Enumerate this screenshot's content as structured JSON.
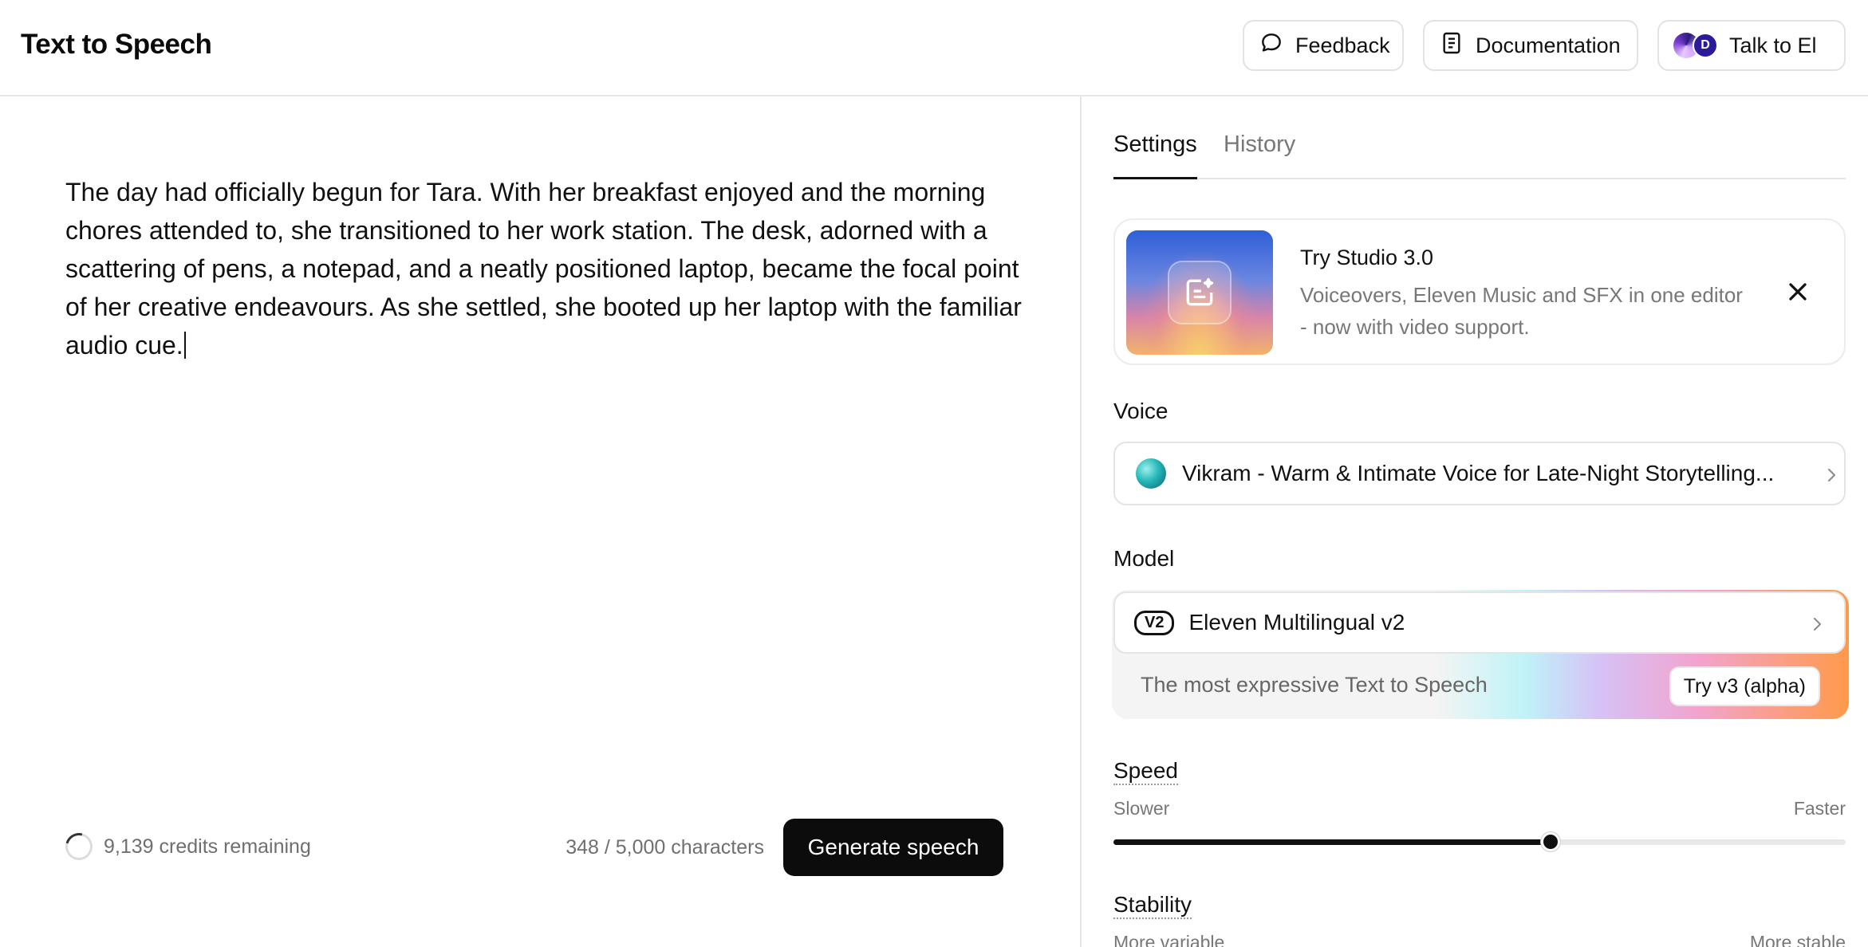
{
  "header": {
    "title": "Text to Speech",
    "feedback_label": "Feedback",
    "docs_label": "Documentation",
    "talk_label": "Talk to El",
    "avatar_initial": "D"
  },
  "editor": {
    "text": "The day had officially begun for Tara. With her breakfast enjoyed and the morning chores attended to, she transitioned to her work station. The desk, adorned with a scattering of pens, a notepad, and a neatly positioned laptop, became the focal point of her creative endeavours. As she settled, she booted up her laptop with the familiar audio cue.",
    "credits": "9,139 credits remaining",
    "char_count": "348 / 5,000 characters",
    "generate_label": "Generate speech"
  },
  "panel": {
    "tabs": [
      {
        "label": "Settings",
        "active": true
      },
      {
        "label": "History",
        "active": false
      }
    ],
    "promo": {
      "title": "Try Studio 3.0",
      "description": "Voiceovers, Eleven Music and SFX in one editor - now with video support."
    },
    "voice_label": "Voice",
    "voice_name": "Vikram - Warm & Intimate Voice for Late-Night Storytelling...",
    "model_label": "Model",
    "model": {
      "badge": "V2",
      "name": "Eleven Multilingual v2",
      "subtitle": "The most expressive Text to Speech",
      "try_label": "Try v3 (alpha)"
    },
    "speed": {
      "label": "Speed",
      "min_label": "Slower",
      "max_label": "Faster",
      "value_fraction": 0.597
    },
    "stability": {
      "label": "Stability",
      "min_label": "More variable",
      "max_label": "More stable"
    }
  },
  "colors": {
    "primary": "#0c0c0c",
    "muted_text": "#777777",
    "border": "#e4e4e4"
  }
}
